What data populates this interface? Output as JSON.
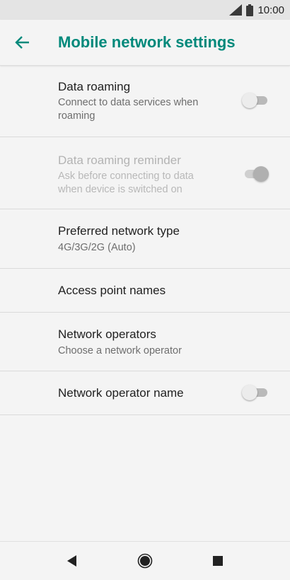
{
  "status_bar": {
    "time": "10:00",
    "icons": [
      "signal-icon",
      "battery-icon"
    ]
  },
  "header": {
    "title": "Mobile network settings",
    "back_icon": "back-arrow-icon",
    "accent": "#00897b"
  },
  "settings": [
    {
      "title": "Data roaming",
      "summary": "Connect to data services when roaming",
      "toggle": "off",
      "enabled": true
    },
    {
      "title": "Data roaming reminder",
      "summary": "Ask before connecting to data when device is switched on",
      "toggle": "on",
      "enabled": false
    },
    {
      "title": "Preferred network type",
      "summary": "4G/3G/2G (Auto)"
    },
    {
      "title": "Access point names"
    },
    {
      "title": "Network operators",
      "summary": "Choose a network operator"
    },
    {
      "title": "Network operator name",
      "toggle": "off",
      "enabled": true
    }
  ],
  "nav_bar": {
    "icons": [
      "back-triangle-icon",
      "home-circle-icon",
      "recents-square-icon"
    ]
  }
}
